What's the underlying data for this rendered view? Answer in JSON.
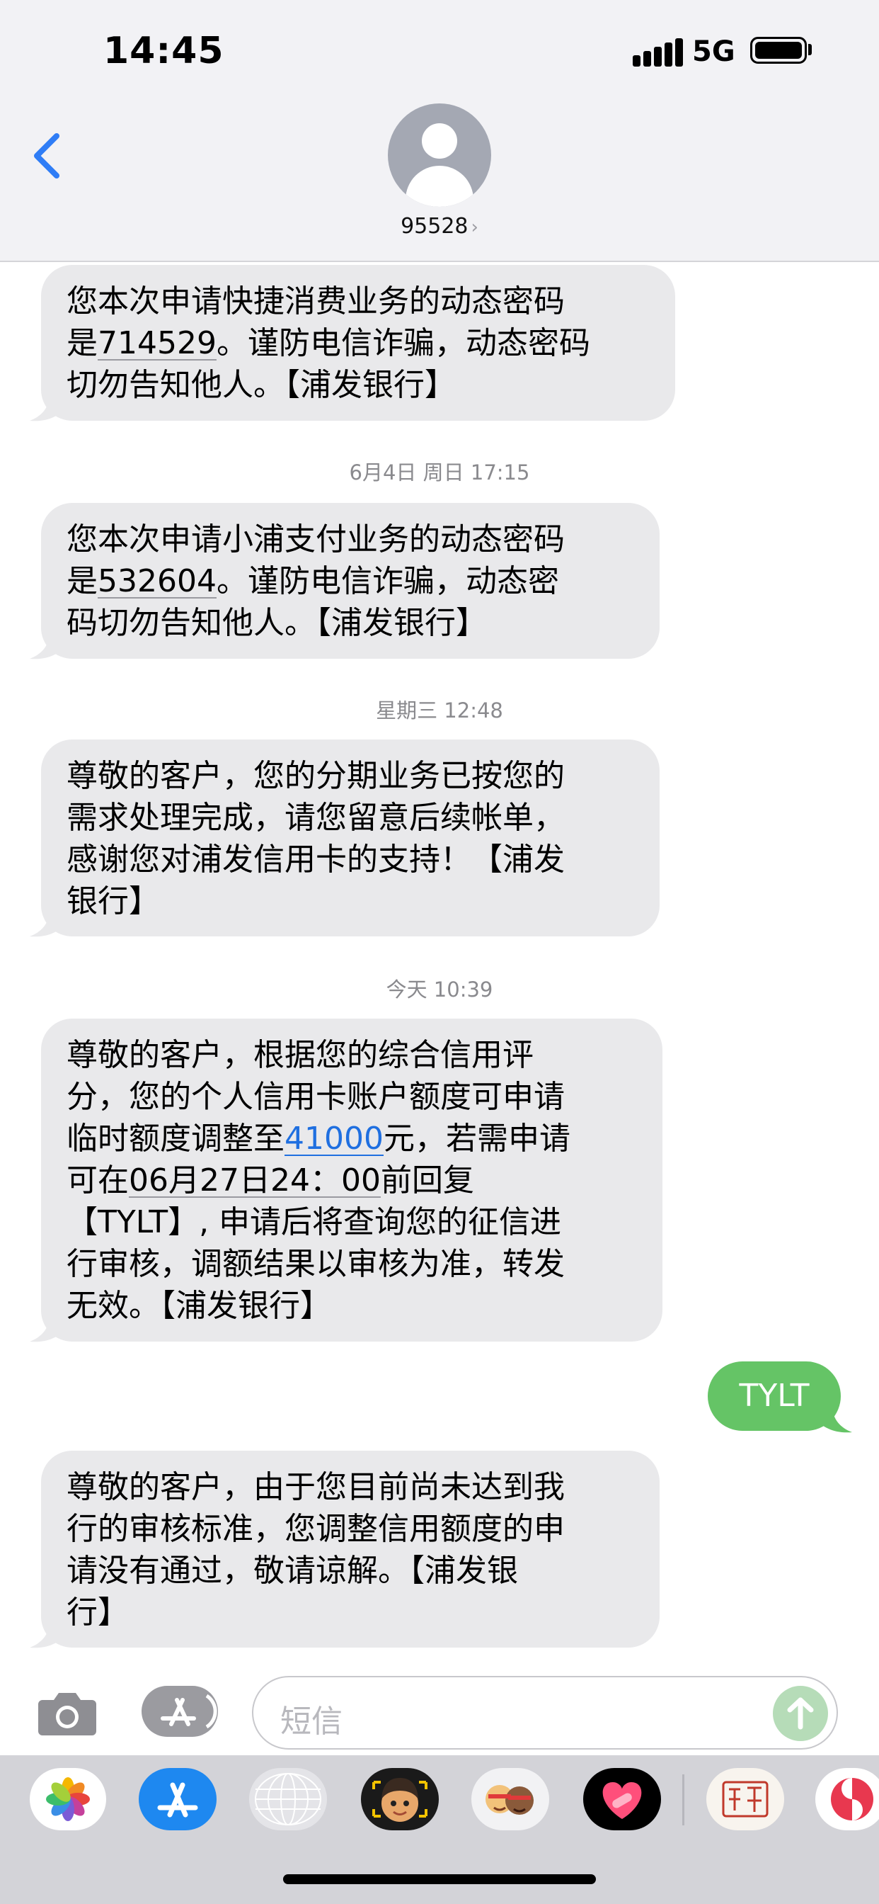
{
  "status_bar": {
    "time": "14:45",
    "network": "5G"
  },
  "header": {
    "contact": "95528",
    "contact_chevron": "›"
  },
  "messages": [
    {
      "lines": [
        "您本次申请快捷消费业务的动态密码",
        "是|714529|。谨防电信诈骗，动态密码",
        "切勿告知他人。【浦发银行】"
      ],
      "code": "714529"
    },
    {
      "lines": [
        "您本次申请小浦支付业务的动态密码",
        "是|532604|。谨防电信诈骗，动态密",
        "码切勿告知他人。【浦发银行】"
      ],
      "code": "532604"
    },
    {
      "lines": [
        "尊敬的客户，您的分期业务已按您的",
        "需求处理完成，请您留意后续帐单，",
        "感谢您对浦发信用卡的支持！【浦发",
        "银行】"
      ]
    },
    {
      "lines": [
        "尊敬的客户，根据您的综合信用评",
        "分，您的个人信用卡账户额度可申请",
        "临时额度调整至|41000|元，若需申请",
        "可在|06月27日24：00|前回复",
        "【TYLT】, 申请后将查询您的征信进",
        "行审核，调额结果以审核为准，转发",
        "无效。【浦发银行】"
      ],
      "amount": "41000",
      "deadline": "06月27日24：00"
    },
    {
      "lines": [
        "尊敬的客户，由于您目前尚未达到我",
        "行的审核标准，您调整信用额度的申",
        "请没有通过，敬请谅解。【浦发银",
        "行】"
      ]
    }
  ],
  "timestamps": [
    "6月4日 周日 17:15",
    "星期三 12:48",
    "今天 10:39"
  ],
  "outgoing": {
    "text": "TYLT"
  },
  "composer": {
    "placeholder": "短信"
  },
  "drawer": {
    "apps": [
      "photos-app-icon",
      "appstore-app-icon",
      "digital-touch-app-icon",
      "memoji-app-icon",
      "memoji-stickers-app-icon",
      "fitness-app-icon",
      "stamp-app-icon",
      "partial-app-icon"
    ]
  },
  "colors": {
    "incoming_bubble": "#e9e9eb",
    "outgoing_bubble": "#65c466",
    "link": "#1f6fe0",
    "accent": "#2f7df6"
  }
}
